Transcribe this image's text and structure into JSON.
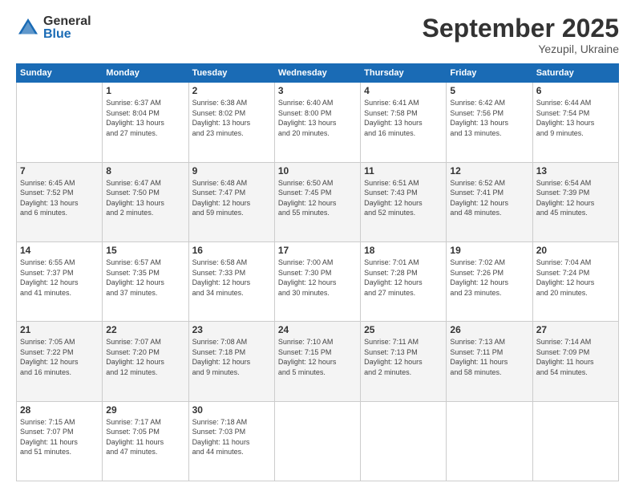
{
  "header": {
    "logo_line1": "General",
    "logo_line2": "Blue",
    "month": "September 2025",
    "location": "Yezupil, Ukraine"
  },
  "weekdays": [
    "Sunday",
    "Monday",
    "Tuesday",
    "Wednesday",
    "Thursday",
    "Friday",
    "Saturday"
  ],
  "weeks": [
    [
      {
        "day": "",
        "info": ""
      },
      {
        "day": "1",
        "info": "Sunrise: 6:37 AM\nSunset: 8:04 PM\nDaylight: 13 hours\nand 27 minutes."
      },
      {
        "day": "2",
        "info": "Sunrise: 6:38 AM\nSunset: 8:02 PM\nDaylight: 13 hours\nand 23 minutes."
      },
      {
        "day": "3",
        "info": "Sunrise: 6:40 AM\nSunset: 8:00 PM\nDaylight: 13 hours\nand 20 minutes."
      },
      {
        "day": "4",
        "info": "Sunrise: 6:41 AM\nSunset: 7:58 PM\nDaylight: 13 hours\nand 16 minutes."
      },
      {
        "day": "5",
        "info": "Sunrise: 6:42 AM\nSunset: 7:56 PM\nDaylight: 13 hours\nand 13 minutes."
      },
      {
        "day": "6",
        "info": "Sunrise: 6:44 AM\nSunset: 7:54 PM\nDaylight: 13 hours\nand 9 minutes."
      }
    ],
    [
      {
        "day": "7",
        "info": "Sunrise: 6:45 AM\nSunset: 7:52 PM\nDaylight: 13 hours\nand 6 minutes."
      },
      {
        "day": "8",
        "info": "Sunrise: 6:47 AM\nSunset: 7:50 PM\nDaylight: 13 hours\nand 2 minutes."
      },
      {
        "day": "9",
        "info": "Sunrise: 6:48 AM\nSunset: 7:47 PM\nDaylight: 12 hours\nand 59 minutes."
      },
      {
        "day": "10",
        "info": "Sunrise: 6:50 AM\nSunset: 7:45 PM\nDaylight: 12 hours\nand 55 minutes."
      },
      {
        "day": "11",
        "info": "Sunrise: 6:51 AM\nSunset: 7:43 PM\nDaylight: 12 hours\nand 52 minutes."
      },
      {
        "day": "12",
        "info": "Sunrise: 6:52 AM\nSunset: 7:41 PM\nDaylight: 12 hours\nand 48 minutes."
      },
      {
        "day": "13",
        "info": "Sunrise: 6:54 AM\nSunset: 7:39 PM\nDaylight: 12 hours\nand 45 minutes."
      }
    ],
    [
      {
        "day": "14",
        "info": "Sunrise: 6:55 AM\nSunset: 7:37 PM\nDaylight: 12 hours\nand 41 minutes."
      },
      {
        "day": "15",
        "info": "Sunrise: 6:57 AM\nSunset: 7:35 PM\nDaylight: 12 hours\nand 37 minutes."
      },
      {
        "day": "16",
        "info": "Sunrise: 6:58 AM\nSunset: 7:33 PM\nDaylight: 12 hours\nand 34 minutes."
      },
      {
        "day": "17",
        "info": "Sunrise: 7:00 AM\nSunset: 7:30 PM\nDaylight: 12 hours\nand 30 minutes."
      },
      {
        "day": "18",
        "info": "Sunrise: 7:01 AM\nSunset: 7:28 PM\nDaylight: 12 hours\nand 27 minutes."
      },
      {
        "day": "19",
        "info": "Sunrise: 7:02 AM\nSunset: 7:26 PM\nDaylight: 12 hours\nand 23 minutes."
      },
      {
        "day": "20",
        "info": "Sunrise: 7:04 AM\nSunset: 7:24 PM\nDaylight: 12 hours\nand 20 minutes."
      }
    ],
    [
      {
        "day": "21",
        "info": "Sunrise: 7:05 AM\nSunset: 7:22 PM\nDaylight: 12 hours\nand 16 minutes."
      },
      {
        "day": "22",
        "info": "Sunrise: 7:07 AM\nSunset: 7:20 PM\nDaylight: 12 hours\nand 12 minutes."
      },
      {
        "day": "23",
        "info": "Sunrise: 7:08 AM\nSunset: 7:18 PM\nDaylight: 12 hours\nand 9 minutes."
      },
      {
        "day": "24",
        "info": "Sunrise: 7:10 AM\nSunset: 7:15 PM\nDaylight: 12 hours\nand 5 minutes."
      },
      {
        "day": "25",
        "info": "Sunrise: 7:11 AM\nSunset: 7:13 PM\nDaylight: 12 hours\nand 2 minutes."
      },
      {
        "day": "26",
        "info": "Sunrise: 7:13 AM\nSunset: 7:11 PM\nDaylight: 11 hours\nand 58 minutes."
      },
      {
        "day": "27",
        "info": "Sunrise: 7:14 AM\nSunset: 7:09 PM\nDaylight: 11 hours\nand 54 minutes."
      }
    ],
    [
      {
        "day": "28",
        "info": "Sunrise: 7:15 AM\nSunset: 7:07 PM\nDaylight: 11 hours\nand 51 minutes."
      },
      {
        "day": "29",
        "info": "Sunrise: 7:17 AM\nSunset: 7:05 PM\nDaylight: 11 hours\nand 47 minutes."
      },
      {
        "day": "30",
        "info": "Sunrise: 7:18 AM\nSunset: 7:03 PM\nDaylight: 11 hours\nand 44 minutes."
      },
      {
        "day": "",
        "info": ""
      },
      {
        "day": "",
        "info": ""
      },
      {
        "day": "",
        "info": ""
      },
      {
        "day": "",
        "info": ""
      }
    ]
  ]
}
